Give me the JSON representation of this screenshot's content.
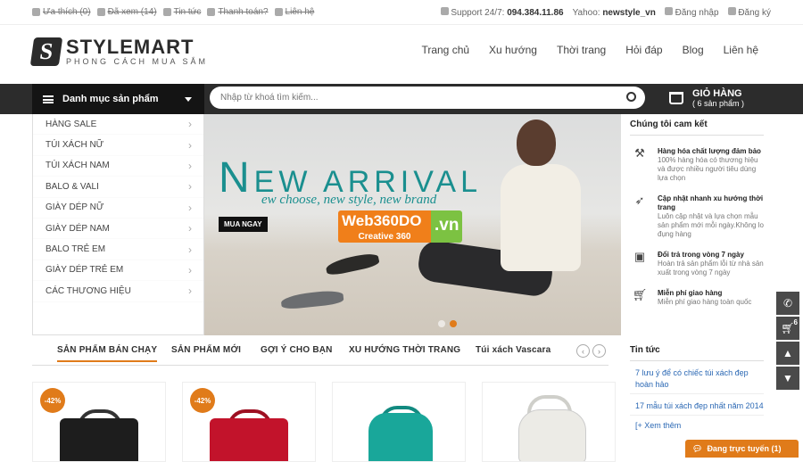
{
  "topbar": {
    "links": [
      "Ưa thích (0)",
      "Đã xem (14)",
      "Tin tức",
      "Thanh toán?",
      "Liên hệ"
    ],
    "support_label": "Support 24/7:",
    "support_phone": "094.384.11.86",
    "yahoo_label": "Yahoo:",
    "yahoo_id": "newstyle_vn",
    "login": "Đăng nhập",
    "register": "Đăng ký"
  },
  "logo": {
    "mark": "S",
    "name": "STYLEMART",
    "slogan": "PHONG CÁCH MUA SẮM"
  },
  "mainnav": [
    "Trang chủ",
    "Xu hướng",
    "Thời trang",
    "Hỏi đáp",
    "Blog",
    "Liên hệ"
  ],
  "category_button": "Danh mục sản phẩm",
  "search": {
    "placeholder": "Nhập từ khoá tìm kiếm..."
  },
  "cart": {
    "title": "GIỎ HÀNG",
    "count_text": "( 6 sản phẩm )"
  },
  "categories": [
    "HÀNG SALE",
    "TÚI XÁCH NỮ",
    "TÚI XÁCH NAM",
    "BALO & VALI",
    "GIÀY DÉP NỮ",
    "GIÀY DÉP NAM",
    "BALO TRẺ EM",
    "GIÀY DÉP TRẺ EM",
    "CÁC THƯƠNG HIỆU"
  ],
  "banner": {
    "headline_initial": "N",
    "headline_rest": "EW ARRIVAL",
    "subline": "ew choose, new style, new brand",
    "buy_label": "MUA NGAY",
    "watermark_main": "Web360DO",
    "watermark_sub": "Creative 360",
    "watermark_tld": ".vn"
  },
  "promise": {
    "title": "Chúng tôi cam kết",
    "items": [
      {
        "title": "Hàng hóa chất lượng đảm bảo",
        "desc": "100% hàng hóa có thương hiệu và được nhiều người tiêu dùng lựa chọn"
      },
      {
        "title": "Cập nhật nhanh xu hướng thời trang",
        "desc": "Luôn cập nhật và lựa chọn mẫu sản phẩm mới mỗi ngày.Không lo đụng hàng"
      },
      {
        "title": "Đổi trả trong vòng 7 ngày",
        "desc": "Hoàn trả sản phẩm lỗi từ nhà sản xuất trong vòng 7 ngày"
      },
      {
        "title": "Miễn phí giao hàng",
        "desc": "Miễn phí giao hàng toàn quốc"
      }
    ]
  },
  "tabs": [
    "SẢN PHẨM BÁN CHẠY",
    "SẢN PHẨM MỚI",
    "GỢI Ý CHO BẠN",
    "XU HƯỚNG THỜI TRANG",
    "Túi xách Vascara"
  ],
  "products": [
    {
      "badge": "-42%"
    },
    {
      "badge": "-42%"
    },
    {
      "badge": ""
    },
    {
      "badge": ""
    }
  ],
  "news": {
    "title": "Tin tức",
    "items": [
      "7 lưu ý để có chiếc túi xách đẹp hoàn hảo",
      "17 mẫu túi xách đẹp nhất năm 2014"
    ],
    "more": "[+ Xem thêm"
  },
  "float": {
    "cart_count": "6"
  },
  "chat": {
    "label": "Đang trực tuyến (1)"
  },
  "colors": {
    "accent": "#e07b1a",
    "teal": "#1a8f8f",
    "dark_bar": "#2c2c2c"
  }
}
